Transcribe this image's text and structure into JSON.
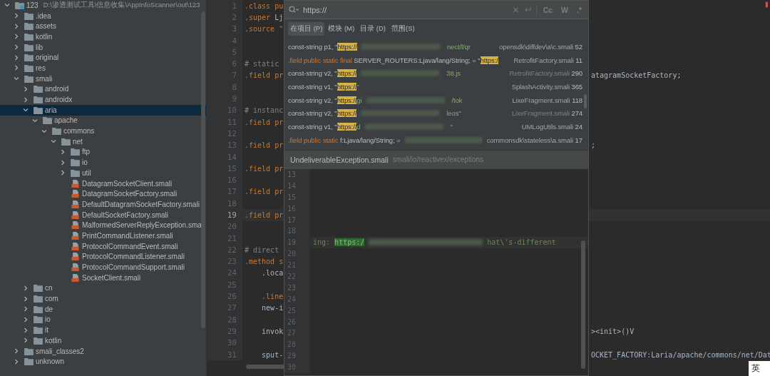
{
  "project_tree": [
    {
      "label": "123",
      "path": "D:\\渗透测试工具\\信息收集\\AppInfoScanner\\out\\123",
      "kind": "module",
      "expanded": true,
      "selected": false,
      "children": [
        {
          "label": ".idea",
          "kind": "folder",
          "expanded": false,
          "selected": false
        },
        {
          "label": "assets",
          "kind": "folder",
          "expanded": false,
          "selected": false
        },
        {
          "label": "kotlin",
          "kind": "folder",
          "expanded": false,
          "selected": false
        },
        {
          "label": "lib",
          "kind": "folder",
          "expanded": false,
          "selected": false
        },
        {
          "label": "original",
          "kind": "folder",
          "expanded": false,
          "selected": false
        },
        {
          "label": "res",
          "kind": "folder",
          "expanded": false,
          "selected": false
        },
        {
          "label": "smali",
          "kind": "folder",
          "expanded": true,
          "selected": false,
          "children": [
            {
              "label": "android",
              "kind": "folder",
              "expanded": false,
              "selected": false
            },
            {
              "label": "androidx",
              "kind": "folder",
              "expanded": false,
              "selected": false
            },
            {
              "label": "aria",
              "kind": "folder",
              "expanded": true,
              "selected": true,
              "children": [
                {
                  "label": "apache",
                  "kind": "folder",
                  "expanded": true,
                  "selected": false,
                  "children": [
                    {
                      "label": "commons",
                      "kind": "folder",
                      "expanded": true,
                      "selected": false,
                      "children": [
                        {
                          "label": "net",
                          "kind": "folder",
                          "expanded": true,
                          "selected": false,
                          "children": [
                            {
                              "label": "ftp",
                              "kind": "folder",
                              "expanded": false,
                              "selected": false
                            },
                            {
                              "label": "io",
                              "kind": "folder",
                              "expanded": false,
                              "selected": false
                            },
                            {
                              "label": "util",
                              "kind": "folder",
                              "expanded": false,
                              "selected": false
                            },
                            {
                              "label": "DatagramSocketClient.smali",
                              "kind": "file",
                              "selected": false
                            },
                            {
                              "label": "DatagramSocketFactory.smali",
                              "kind": "file",
                              "selected": false
                            },
                            {
                              "label": "DefaultDatagramSocketFactory.smali",
                              "kind": "file",
                              "selected": false
                            },
                            {
                              "label": "DefaultSocketFactory.smali",
                              "kind": "file",
                              "selected": false
                            },
                            {
                              "label": "MalformedServerReplyException.sma",
                              "kind": "file",
                              "selected": false
                            },
                            {
                              "label": "PrintCommandListener.smali",
                              "kind": "file",
                              "selected": false
                            },
                            {
                              "label": "ProtocolCommandEvent.smali",
                              "kind": "file",
                              "selected": false
                            },
                            {
                              "label": "ProtocolCommandListener.smali",
                              "kind": "file",
                              "selected": false
                            },
                            {
                              "label": "ProtocolCommandSupport.smali",
                              "kind": "file",
                              "selected": false
                            },
                            {
                              "label": "SocketClient.smali",
                              "kind": "file",
                              "selected": false
                            }
                          ]
                        }
                      ]
                    }
                  ]
                }
              ]
            },
            {
              "label": "cn",
              "kind": "folder",
              "expanded": false,
              "selected": false
            },
            {
              "label": "com",
              "kind": "folder",
              "expanded": false,
              "selected": false
            },
            {
              "label": "de",
              "kind": "folder",
              "expanded": false,
              "selected": false
            },
            {
              "label": "io",
              "kind": "folder",
              "expanded": false,
              "selected": false
            },
            {
              "label": "it",
              "kind": "folder",
              "expanded": false,
              "selected": false
            },
            {
              "label": "kotlin",
              "kind": "folder",
              "expanded": false,
              "selected": false
            }
          ]
        },
        {
          "label": "smali_classes2",
          "kind": "folder",
          "expanded": false,
          "selected": false
        },
        {
          "label": "unknown",
          "kind": "folder",
          "expanded": false,
          "selected": false
        }
      ]
    }
  ],
  "editor": {
    "lines": [
      {
        "number": "1",
        "start": [
          {
            "text": ".class pu",
            "kind": "keyword"
          }
        ]
      },
      {
        "number": "2",
        "start": [
          {
            "text": ".super",
            "kind": "keyword"
          },
          {
            "text": " Lj",
            "kind": "plain"
          }
        ]
      },
      {
        "number": "3",
        "start": [
          {
            "text": ".source ",
            "kind": "keyword"
          },
          {
            "text": "\"",
            "kind": "string"
          }
        ]
      },
      {
        "number": "4"
      },
      {
        "number": "5"
      },
      {
        "number": "6",
        "start": [
          {
            "text": "# static",
            "kind": "comment"
          }
        ]
      },
      {
        "number": "7",
        "start": [
          {
            "text": ".field pr",
            "kind": "keyword"
          }
        ],
        "end": "atagramSocketFactory;"
      },
      {
        "number": "8"
      },
      {
        "number": "9"
      },
      {
        "number": "10",
        "start": [
          {
            "text": "# instanc",
            "kind": "comment"
          }
        ]
      },
      {
        "number": "11",
        "start": [
          {
            "text": ".field pr",
            "kind": "keyword"
          }
        ]
      },
      {
        "number": "12"
      },
      {
        "number": "13",
        "start": [
          {
            "text": ".field pr",
            "kind": "keyword"
          }
        ],
        "end": ";"
      },
      {
        "number": "14"
      },
      {
        "number": "15",
        "start": [
          {
            "text": ".field pr",
            "kind": "keyword"
          }
        ]
      },
      {
        "number": "16"
      },
      {
        "number": "17",
        "start": [
          {
            "text": ".field pr",
            "kind": "keyword"
          }
        ]
      },
      {
        "number": "18"
      },
      {
        "number": "19",
        "current": true,
        "start": [
          {
            "text": ".field pr",
            "kind": "keyword"
          }
        ]
      },
      {
        "number": "20"
      },
      {
        "number": "21"
      },
      {
        "number": "22",
        "start": [
          {
            "text": "# direct",
            "kind": "comment"
          }
        ]
      },
      {
        "number": "23",
        "start": [
          {
            "text": ".method s",
            "kind": "keyword"
          }
        ]
      },
      {
        "number": "24",
        "start": [
          {
            "text": "    .loca",
            "kind": "plain"
          }
        ]
      },
      {
        "number": "25"
      },
      {
        "number": "26",
        "start": [
          {
            "text": "    .line",
            "kind": "keyword"
          }
        ]
      },
      {
        "number": "27",
        "start": [
          {
            "text": "    new-i",
            "kind": "plain"
          }
        ]
      },
      {
        "number": "28"
      },
      {
        "number": "29",
        "start": [
          {
            "text": "    invok",
            "kind": "plain"
          }
        ],
        "end": "><init>()V"
      },
      {
        "number": "30"
      },
      {
        "number": "31",
        "start": [
          {
            "text": "    sput-",
            "kind": "plain"
          }
        ],
        "end": "OCKET_FACTORY:Laria/apache/commons/net/Dat"
      }
    ]
  },
  "find_popup": {
    "query": "https://",
    "options": [
      "Cc",
      "W",
      ".*"
    ],
    "scopes": [
      {
        "label": "在项目 (P)",
        "selected": true
      },
      {
        "label": "模块 (M)",
        "selected": false
      },
      {
        "label": "目录 (D)",
        "selected": false
      },
      {
        "label": "范围(S)",
        "selected": false
      }
    ],
    "results": [
      {
        "code": "const-string p1, \"",
        "match": "https://",
        "redacted": true,
        "tail": "nect/l/qr",
        "file": "opensdk\\diffdev\\a\\c.smali",
        "line": "52",
        "dim": false
      },
      {
        "keyword": ".field public static final",
        "code": " SERVER_ROUTERS:Ljava/lang/String; = \"",
        "match": "https:/",
        "redacted": false,
        "file": "RetrofitFactory.smali",
        "line": "11",
        "dim": false
      },
      {
        "code": "const-string v2, \"",
        "match": "https://",
        "redacted": true,
        "tail": "38.js",
        "file": "RetrofitFactory.smali",
        "line": "290",
        "dim": true
      },
      {
        "code": "const-string v1, \"",
        "match": "https://",
        "after": "\"",
        "redacted": false,
        "file": "SplashActivity.smali",
        "line": "365",
        "dim": false
      },
      {
        "code": "const-string v2, \"",
        "match": "https://",
        "after": "gi",
        "redacted": true,
        "tail": "/tok",
        "file": "LixeFragment.smali",
        "line": "118",
        "dim": false
      },
      {
        "code": "const-string v2, \"",
        "match": "https://",
        "redacted": true,
        "tail": "leos\"",
        "file": "LixeFragment.smali",
        "line": "274",
        "dim": true
      },
      {
        "code": "const-string v1, \"",
        "match": "https://",
        "after": "d",
        "redacted": true,
        "tail": "\"",
        "file": "UMLogUtils.smali",
        "line": "24",
        "dim": false
      },
      {
        "keyword": ".field public static",
        "code": " f:Ljava/lang/String; = ",
        "redacted": true,
        "file": "commonsdk\\stateless\\a.smali",
        "line": "17",
        "dim": false
      }
    ],
    "preview": {
      "file": "UndeliverableException.smali",
      "path": "smali/io/reactivex/exceptions",
      "lines": [
        {
          "number": "13"
        },
        {
          "number": "14"
        },
        {
          "number": "15"
        },
        {
          "number": "16"
        },
        {
          "number": "17"
        },
        {
          "number": "18"
        },
        {
          "number": "19",
          "current": true,
          "prefix": "ing: ",
          "match": "https:/",
          "redacted": true,
          "tail": "hat\\'s-different"
        },
        {
          "number": "20"
        },
        {
          "number": "21"
        },
        {
          "number": "22"
        },
        {
          "number": "23"
        },
        {
          "number": "24"
        },
        {
          "number": "25"
        },
        {
          "number": "26"
        },
        {
          "number": "27"
        },
        {
          "number": "28"
        },
        {
          "number": "29"
        },
        {
          "number": "30"
        }
      ]
    }
  },
  "ime_indicator": "英"
}
